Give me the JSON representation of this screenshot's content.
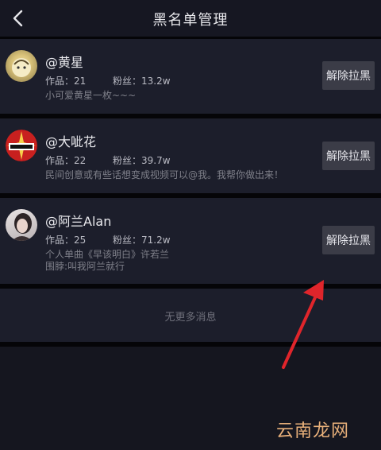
{
  "header": {
    "title": "黑名单管理",
    "back_icon": "chevron-left-icon"
  },
  "items": [
    {
      "name": "@黄星",
      "works": "作品：21",
      "fans": "粉丝：13.2w",
      "desc": "小可爱黄星一枚~~~",
      "button": "解除拉黑"
    },
    {
      "name": "@大呲花",
      "works": "作品：22",
      "fans": "粉丝：39.7w",
      "desc": "民间创意或有些话想变成视频可以@我。我帮你做出来！",
      "button": "解除拉黑"
    },
    {
      "name": "@阿兰Alan",
      "works": "作品：25",
      "fans": "粉丝：71.2w",
      "desc": "个人单曲《早该明白》许若兰",
      "desc2": "围脖:叫我阿兰就行",
      "button": "解除拉黑"
    }
  ],
  "footer": {
    "no_more": "无更多消息"
  },
  "watermark": "云南龙网",
  "colors": {
    "annotation_arrow": "#e0252b",
    "watermark": "#e8b07a"
  }
}
